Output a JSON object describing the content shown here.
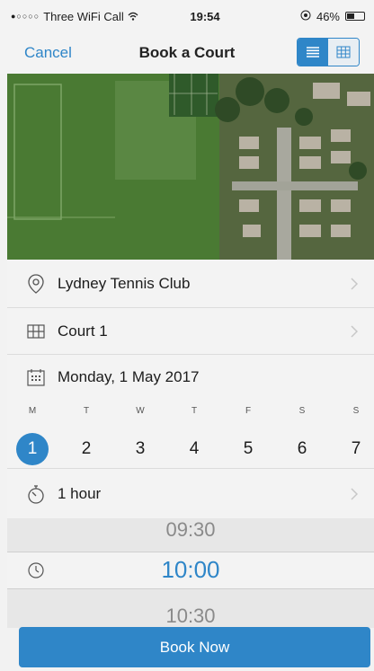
{
  "status": {
    "signal": "●○○○○",
    "carrier": "Three WiFi Call",
    "time": "19:54",
    "battery": "46%",
    "battery_level": 0.46
  },
  "nav": {
    "cancel": "Cancel",
    "title": "Book a Court"
  },
  "venue": {
    "label": "Lydney Tennis Club"
  },
  "court": {
    "label": "Court 1"
  },
  "date": {
    "label": "Monday, 1 May 2017"
  },
  "days": [
    {
      "letter": "M",
      "num": "1"
    },
    {
      "letter": "T",
      "num": "2"
    },
    {
      "letter": "W",
      "num": "3"
    },
    {
      "letter": "T",
      "num": "4"
    },
    {
      "letter": "F",
      "num": "5"
    },
    {
      "letter": "S",
      "num": "6"
    },
    {
      "letter": "S",
      "num": "7"
    }
  ],
  "duration": {
    "label": "1 hour"
  },
  "times": {
    "prev": "09:30",
    "current": "10:00",
    "next": "10:30"
  },
  "book_label": "Book Now",
  "colors": {
    "accent": "#2f86c8"
  }
}
